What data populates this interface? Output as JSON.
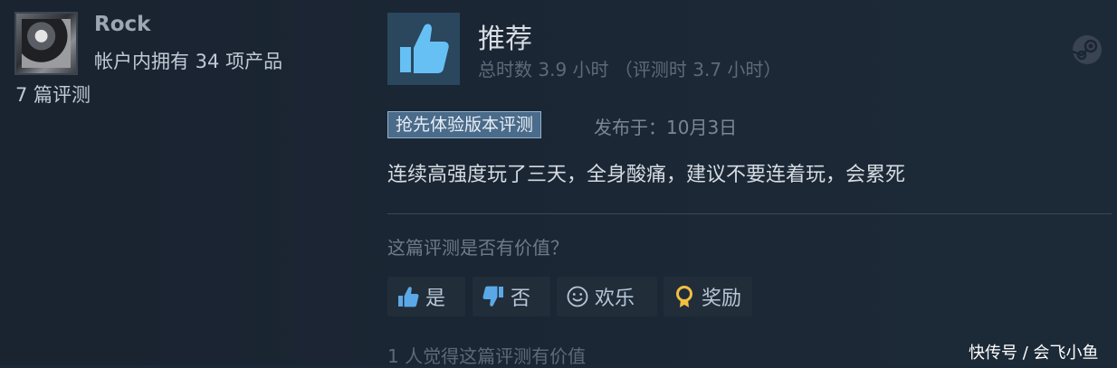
{
  "reviewer": {
    "username": "Rock",
    "products_owned": "帐户内拥有 34 项产品",
    "reviews_count": "7 篇评测"
  },
  "review": {
    "verdict": "推荐",
    "playtime": "总时数 3.9 小时 （评测时 3.7 小时）",
    "early_access_label": "抢先体验版本评测",
    "posted": "发布于：10月3日",
    "text": "连续高强度玩了三天，全身酸痛，建议不要连着玩，会累死",
    "helpful_question": "这篇评测是否有价值？",
    "buttons": {
      "yes": "是",
      "no": "否",
      "funny": "欢乐",
      "award": "奖励"
    },
    "found_helpful": "1 人觉得这篇评测有价值"
  },
  "watermark": "快传号 / 会飞小鱼",
  "icons": {
    "verdict": "thumbs-up-icon",
    "platform": "steam-logo-icon",
    "yes": "thumbs-up-icon",
    "no": "thumbs-down-icon",
    "funny": "smiley-icon",
    "award": "award-ribbon-icon"
  },
  "colors": {
    "background": "#1b2838",
    "accent": "#66c0f4",
    "early_access_badge": "#4a6b8a",
    "award_icon": "#f0c040"
  }
}
